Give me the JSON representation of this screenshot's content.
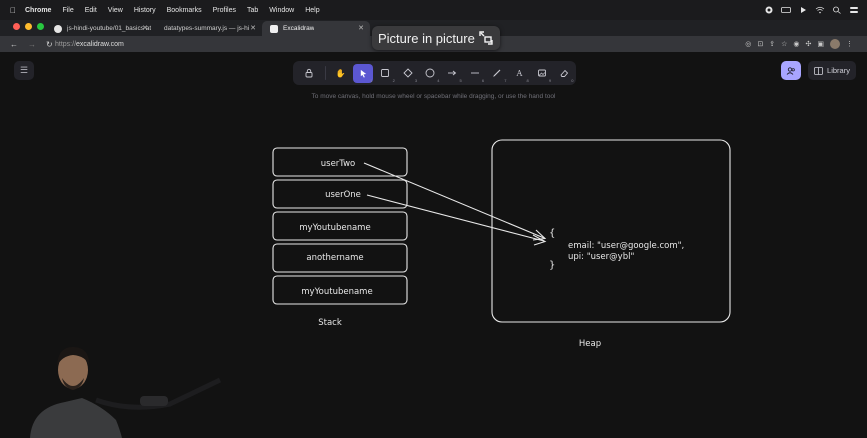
{
  "menubar": {
    "apple": "",
    "app_name": "Chrome",
    "items": [
      "File",
      "Edit",
      "View",
      "History",
      "Bookmarks",
      "Profiles",
      "Tab",
      "Window",
      "Help"
    ]
  },
  "tabs": [
    {
      "title": "js-hindi-youtube/01_basics at",
      "active": false
    },
    {
      "title": "datatypes-summary.js — js-hi",
      "active": false
    },
    {
      "title": "Excalidraw",
      "active": true
    }
  ],
  "address_bar": {
    "scheme": "https://",
    "host": "excalidraw.com"
  },
  "pip": {
    "label": "Picture in picture"
  },
  "excalidraw": {
    "hint": "To move canvas, hold mouse wheel or spacebar while dragging, or use the hand tool",
    "library_label": "Library",
    "tools": [
      {
        "name": "lock",
        "key": ""
      },
      {
        "name": "hand",
        "key": ""
      },
      {
        "name": "selection",
        "key": "1",
        "active": true
      },
      {
        "name": "rectangle",
        "key": "2"
      },
      {
        "name": "diamond",
        "key": "3"
      },
      {
        "name": "ellipse",
        "key": "4"
      },
      {
        "name": "arrow",
        "key": "5"
      },
      {
        "name": "line",
        "key": "6"
      },
      {
        "name": "draw",
        "key": "7"
      },
      {
        "name": "text",
        "key": "8"
      },
      {
        "name": "image",
        "key": "9"
      },
      {
        "name": "eraser",
        "key": "0"
      }
    ]
  },
  "drawing": {
    "stack_label": "Stack",
    "heap_label": "Heap",
    "stack_items": [
      "userTwo",
      "userOne",
      "myYoutubename",
      "anothername",
      "myYoutubename"
    ],
    "heap_open_brace": "{",
    "heap_close_brace": "}",
    "heap_line1": "email: \"user@google.com\",",
    "heap_line2": "upi: \"user@ybl\""
  },
  "colors": {
    "accent": "#5b57d1",
    "collab": "#a8a5ff",
    "canvas_bg": "#121212",
    "stroke": "#e8e8e8"
  }
}
